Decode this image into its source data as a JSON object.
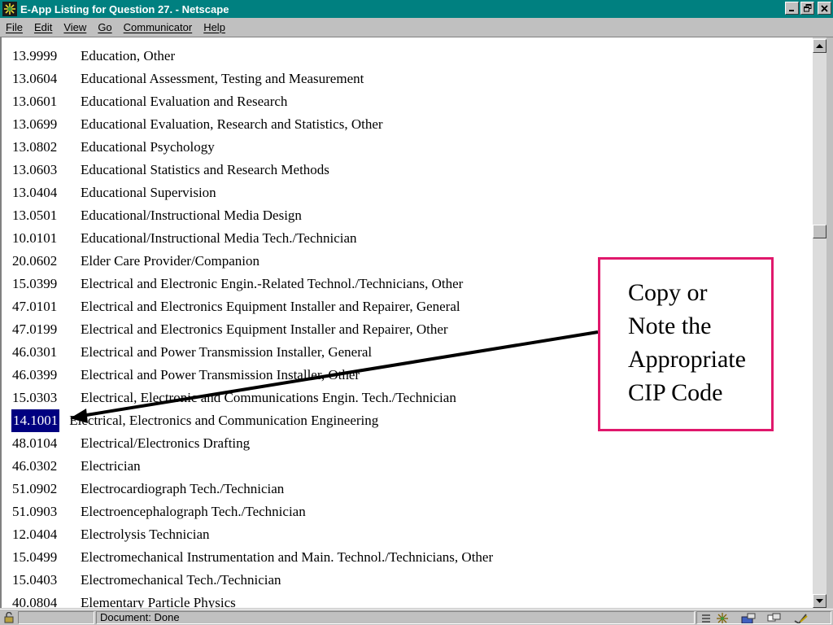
{
  "window": {
    "title": "E-App Listing for Question 27. - Netscape",
    "colors": {
      "titlebar": "#008080",
      "selection": "#000080",
      "callout_border": "#e0186c"
    }
  },
  "menu": [
    "File",
    "Edit",
    "View",
    "Go",
    "Communicator",
    "Help"
  ],
  "listing": [
    {
      "code": "13.9999",
      "name": "Education, Other"
    },
    {
      "code": "13.0604",
      "name": "Educational Assessment, Testing and Measurement"
    },
    {
      "code": "13.0601",
      "name": "Educational Evaluation and Research"
    },
    {
      "code": "13.0699",
      "name": "Educational Evaluation, Research and Statistics, Other"
    },
    {
      "code": "13.0802",
      "name": "Educational Psychology"
    },
    {
      "code": "13.0603",
      "name": "Educational Statistics and Research Methods"
    },
    {
      "code": "13.0404",
      "name": "Educational Supervision"
    },
    {
      "code": "13.0501",
      "name": "Educational/Instructional Media Design"
    },
    {
      "code": "10.0101",
      "name": "Educational/Instructional Media Tech./Technician"
    },
    {
      "code": "20.0602",
      "name": "Elder Care Provider/Companion"
    },
    {
      "code": "15.0399",
      "name": "Electrical and Electronic Engin.-Related Technol./Technicians, Other"
    },
    {
      "code": "47.0101",
      "name": "Electrical and Electronics Equipment Installer and Repairer, General"
    },
    {
      "code": "47.0199",
      "name": "Electrical and Electronics Equipment Installer and Repairer, Other"
    },
    {
      "code": "46.0301",
      "name": "Electrical and Power Transmission Installer, General"
    },
    {
      "code": "46.0399",
      "name": "Electrical and Power Transmission Installer, Other"
    },
    {
      "code": "15.0303",
      "name": "Electrical, Electronic and Communications Engin. Tech./Technician"
    },
    {
      "code": "14.1001",
      "name": "Electrical, Electronics and Communication Engineering",
      "selected": true
    },
    {
      "code": "48.0104",
      "name": "Electrical/Electronics Drafting"
    },
    {
      "code": "46.0302",
      "name": "Electrician"
    },
    {
      "code": "51.0902",
      "name": "Electrocardiograph Tech./Technician"
    },
    {
      "code": "51.0903",
      "name": "Electroencephalograph Tech./Technician"
    },
    {
      "code": "12.0404",
      "name": "Electrolysis Technician"
    },
    {
      "code": "15.0499",
      "name": "Electromechanical Instrumentation and Main. Technol./Technicians, Other"
    },
    {
      "code": "15.0403",
      "name": "Electromechanical Tech./Technician"
    },
    {
      "code": "40.0804",
      "name": "Elementary Particle Physics"
    }
  ],
  "callout": {
    "lines": [
      "Copy or",
      "Note the",
      "Appropriate",
      "CIP Code"
    ]
  },
  "status": {
    "text": "Document: Done"
  },
  "icons": {
    "app": "netscape-logo-icon",
    "status": [
      "security-lock-icon",
      "component-bar-icon",
      "navigator-icon",
      "mail-icon",
      "discussion-icon",
      "composer-icon"
    ]
  }
}
